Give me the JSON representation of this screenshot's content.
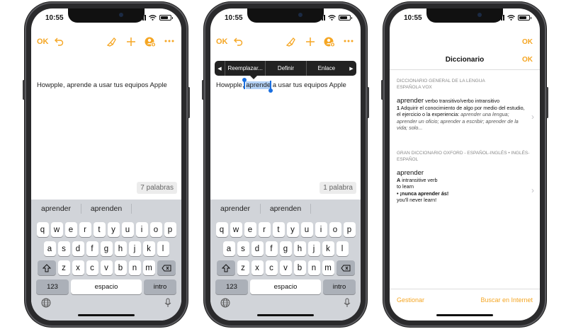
{
  "status": {
    "time": "10:55"
  },
  "colors": {
    "accent": "#f5a623",
    "selection": "#b3d1f5",
    "handle": "#1a6fe0"
  },
  "icons": [
    "undo-icon",
    "brush-icon",
    "plus-icon",
    "add-person-icon",
    "more-icon",
    "globe-icon",
    "mic-icon",
    "shift-icon",
    "delete-icon",
    "wifi-icon",
    "battery-icon"
  ],
  "notes": {
    "ok_label": "OK",
    "note_text": "Howpple, aprende a usar tus equipos Apple",
    "note_before": "Howpple, ",
    "selected_word": "aprende",
    "note_after": " a usar tus equipos Apple"
  },
  "phone1": {
    "word_count": "7 palabras"
  },
  "phone2": {
    "word_count": "1 palabra",
    "menu": {
      "prev": "◀",
      "items": [
        "Reemplazar...",
        "Definir",
        "Enlace"
      ],
      "next": "▶"
    }
  },
  "keyboard": {
    "suggestions": [
      "aprender",
      "aprenden",
      ""
    ],
    "row1": [
      "q",
      "w",
      "e",
      "r",
      "t",
      "y",
      "u",
      "i",
      "o",
      "p"
    ],
    "row2": [
      "a",
      "s",
      "d",
      "f",
      "g",
      "h",
      "j",
      "k",
      "l"
    ],
    "row3": [
      "z",
      "x",
      "c",
      "v",
      "b",
      "n",
      "m"
    ],
    "num_label": "123",
    "space_label": "espacio",
    "return_label": "intro"
  },
  "dictionary": {
    "ok_top": "OK",
    "title": "Diccionario",
    "ok": "OK",
    "entry1": {
      "source": "DICCIONARIO GENERAL DE LA LENGUA ESPAÑOLA VOX",
      "word": "aprender",
      "pos": "verbo transitivo/verbo intransitivo",
      "sense_num": "1",
      "definition": "Adquirir el conocimiento de algo por medio del estudio, el ejercicio o la experiencia:",
      "examples": "aprender una lengua; aprender un oficio; aprender a escribir; aprender de la vida; solo..."
    },
    "entry2": {
      "source": "GRAN DICCIONARIO OXFORD - ESPAÑOL-INGLÉS • INGLÉS-ESPAÑOL",
      "word": "aprender",
      "sense_letter": "A",
      "pos": "intransitive verb",
      "translation": "to learn",
      "bullet": "•",
      "example": "¡nunca aprender ás!",
      "example_translation": "you'll never learn!"
    },
    "manage_label": "Gestionar",
    "search_label": "Buscar en Internet"
  }
}
